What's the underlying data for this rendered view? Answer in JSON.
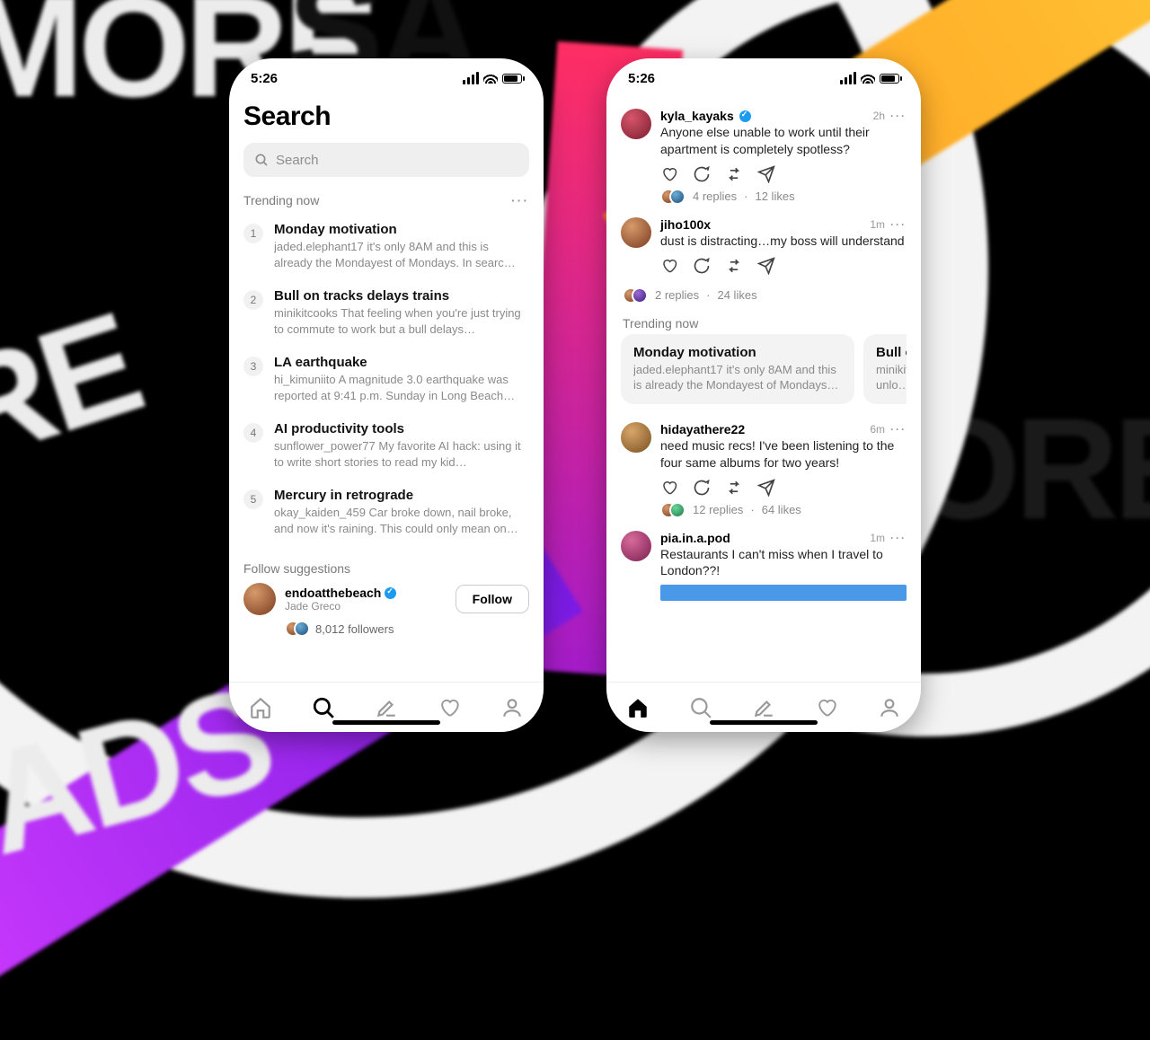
{
  "status": {
    "time": "5:26"
  },
  "phone1": {
    "title": "Search",
    "search_placeholder": "Search",
    "trending_label": "Trending now",
    "trends": [
      {
        "rank": "1",
        "title": "Monday motivation",
        "user": "jaded.elephant17",
        "excerpt": "it's only 8AM and this is already the Mondayest of Mondays. In searc…"
      },
      {
        "rank": "2",
        "title": "Bull on tracks delays trains",
        "user": "minikitcooks",
        "excerpt": "That feeling when you're just trying to commute to work but a bull delays…"
      },
      {
        "rank": "3",
        "title": "LA earthquake",
        "user": "hi_kimuniito",
        "excerpt": "A magnitude 3.0 earthquake was reported at 9:41 p.m. Sunday in Long Beach…"
      },
      {
        "rank": "4",
        "title": "AI productivity tools",
        "user": "sunflower_power77",
        "excerpt": "My favorite AI hack: using it to write short stories to read my kid…"
      },
      {
        "rank": "5",
        "title": "Mercury in retrograde",
        "user": "okay_kaiden_459",
        "excerpt": "Car broke down, nail broke, and now it's raining. This could only mean on…"
      }
    ],
    "suggestions_label": "Follow suggestions",
    "suggestion": {
      "username": "endoatthebeach",
      "name": "Jade Greco",
      "follow": "Follow",
      "followers": "8,012 followers"
    }
  },
  "phone2": {
    "posts": [
      {
        "user": "kyla_kayaks",
        "verified": true,
        "time": "2h",
        "text": "Anyone else unable to work until their apartment is completely spotless?",
        "replies": "4 replies",
        "likes": "12 likes"
      },
      {
        "user": "jiho100x",
        "verified": false,
        "time": "1m",
        "text": "dust is distracting…my boss will understand",
        "replies": "2 replies",
        "likes": "24 likes"
      }
    ],
    "trending_label": "Trending now",
    "cards": [
      {
        "title": "Monday motivation",
        "user": "jaded.elephant17",
        "excerpt": "it's only 8AM and this is already the Mondayest of Mondays…"
      },
      {
        "title": "Bull on",
        "user": "minikitc",
        "excerpt": "up unlo…"
      }
    ],
    "posts2": [
      {
        "user": "hidayathere22",
        "time": "6m",
        "text": "need music recs! I've been listening to the four same albums for two years!",
        "replies": "12 replies",
        "likes": "64 likes"
      },
      {
        "user": "pia.in.a.pod",
        "time": "1m",
        "text": "Restaurants I can't miss when I travel to London??!"
      }
    ]
  }
}
